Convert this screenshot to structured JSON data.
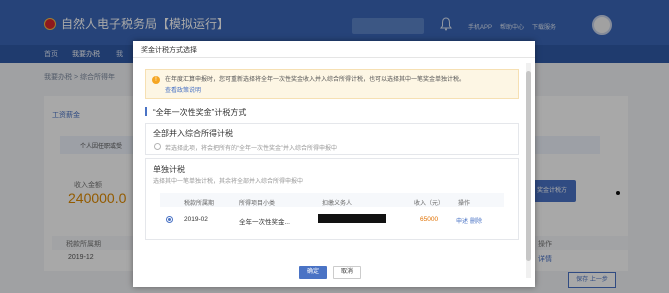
{
  "app": {
    "title": "自然人电子税务局【模拟运行】"
  },
  "header": {
    "links": [
      "手机APP",
      "帮助中心",
      "下载服务"
    ]
  },
  "nav": {
    "items": [
      "首页",
      "我要办税",
      "我"
    ]
  },
  "breadcrumb": "我要办税 > 综合所得年",
  "background": {
    "tab_label": "工资薪金",
    "notice_text": "个人因任职或受",
    "income_label": "收入金额",
    "income_value": "240000.0",
    "action_button": "奖金计税方",
    "table_header": "税款所属期",
    "table_col_action": "操作",
    "row_period": "2019-12",
    "row_action": "详情",
    "next_button": "保存 上一步"
  },
  "modal": {
    "title": "奖金计税方式选择",
    "notice_text": "在年度汇算申报时，您可重新选择将全年一次性奖金收入并入综合所得计税，也可以选择其中一笔奖金单独计税。",
    "notice_link": "查看政策说明",
    "section_title": "“全年一次性奖金”计税方式",
    "option_combined": {
      "title": "全部并入综合所得计税",
      "desc": "若选择此项，将会把所有的“全年一次性奖金”并入综合所得申报中"
    },
    "option_separate": {
      "title": "单独计税",
      "desc": "选择其中一笔单独计税，其余将全部并入综合所得申报中",
      "columns": [
        "税款所属期",
        "所得项目小类",
        "扣缴义务人",
        "收入（元）",
        "操作"
      ],
      "rows": [
        {
          "period": "2019-02",
          "category": "全年一次性奖金...",
          "amount": "65000",
          "action_apply": "申述",
          "action_delete": "删除"
        }
      ]
    },
    "ok_label": "确定",
    "cancel_label": "取消"
  },
  "colors": {
    "primary": "#4a73c5",
    "header": "#3a66b8",
    "warning": "#f5a623",
    "amount": "#e07000"
  }
}
